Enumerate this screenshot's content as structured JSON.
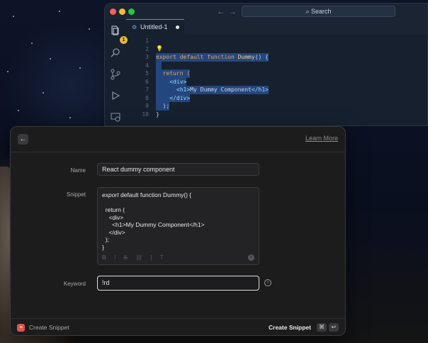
{
  "editor": {
    "search_label": "Search",
    "tab_label": "Untitled-1",
    "explorer_badge": "1",
    "line_numbers": [
      "1",
      "2",
      "3",
      "4",
      "5",
      "6",
      "7",
      "8",
      "9",
      "10"
    ],
    "code_lines": [
      {
        "kw": "",
        "rest": ""
      },
      {
        "kw": "",
        "rest": ""
      },
      {
        "kw": "export default function ",
        "fn": "Dummy",
        "rest": "() {"
      },
      {
        "kw": "",
        "rest": ""
      },
      {
        "kw": "  return (",
        "rest": ""
      },
      {
        "kw": "",
        "tag": "    <div>",
        "rest": ""
      },
      {
        "kw": "",
        "tag": "      <h1>",
        "rest": "My Dummy Component",
        "tag2": "</h1>"
      },
      {
        "kw": "",
        "tag": "    </div>",
        "rest": ""
      },
      {
        "kw": "",
        "rest": "  );"
      },
      {
        "kw": "",
        "rest": "}"
      }
    ]
  },
  "form": {
    "learn_more": "Learn More",
    "name_label": "Name",
    "name_value": "React dummy component",
    "snippet_label": "Snippet",
    "snippet_first_it": "export",
    "snippet_first_rest": " default function Dummy() {",
    "snippet_lines": [
      "",
      "  return (",
      "    <div>",
      "      <h1>My Dummy Component</h1>",
      "    </div>",
      "  );",
      "}"
    ],
    "format_buttons": [
      "B",
      "I",
      "S",
      "⛓",
      "|",
      "T"
    ],
    "keyword_label": "Keyword",
    "keyword_value": "!rd"
  },
  "footer": {
    "title": "Create Snippet",
    "action": "Create Snippet",
    "shortcut_1": "⌘",
    "shortcut_2": "↩"
  }
}
